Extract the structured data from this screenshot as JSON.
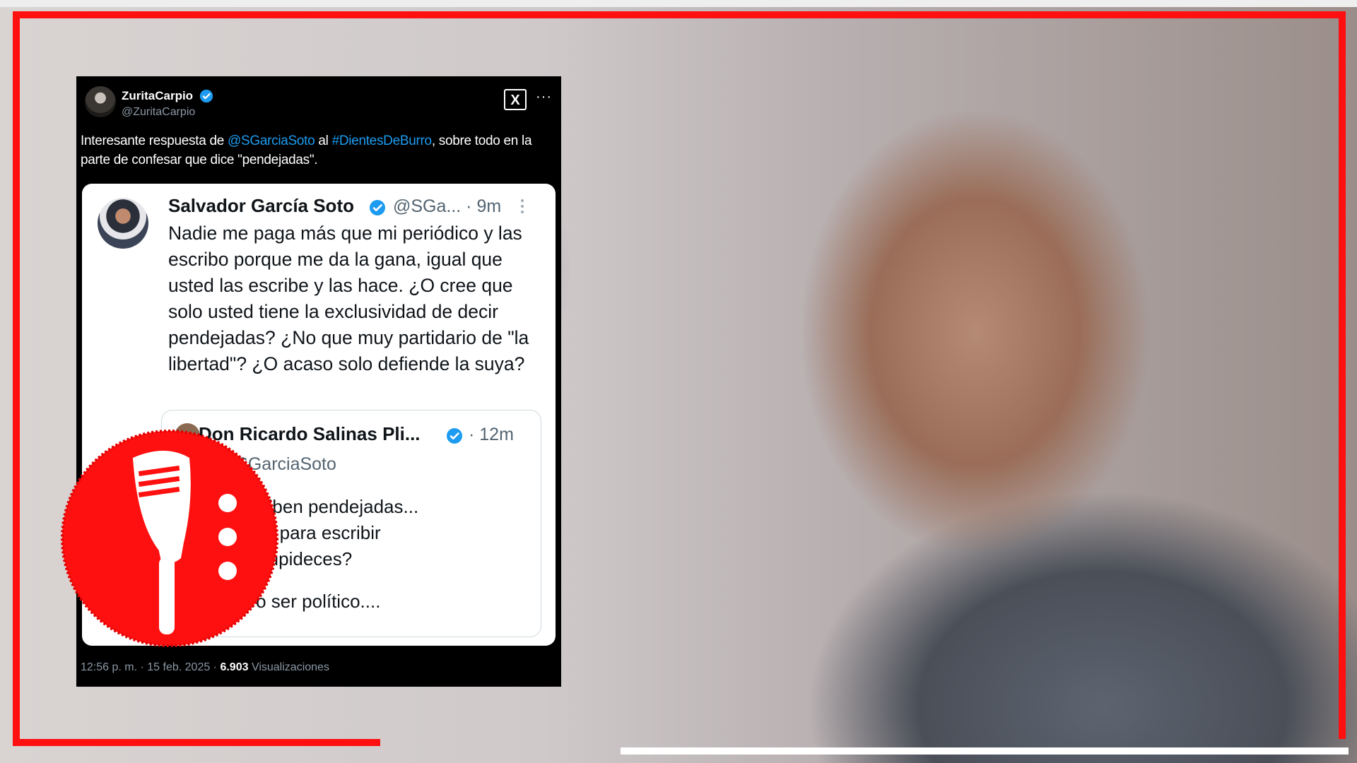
{
  "tweet": {
    "author_name": "ZuritaCarpio",
    "author_handle": "@ZuritaCarpio",
    "x_label": "X",
    "more_label": "···",
    "text_part1": "Interesante respuesta de ",
    "mention": "@SGarciaSoto",
    "text_part2": " al ",
    "hashtag": "#DientesDeBurro",
    "text_part3": ", sobre todo en la parte de confesar que dice \"pendejadas\".",
    "timestamp": "12:56 p. m. · 15 feb. 2025 · ",
    "views_count": "6.903",
    "views_label": " Visualizaciones"
  },
  "embedded": {
    "author_name": "Salvador García Soto",
    "author_handle_time": "@SGa... · 9m",
    "text": "Nadie me paga más que mi periódico y las escribo porque me da la gana, igual que usted las escribe y las hace. ¿O cree que solo usted tiene la exclusividad de decir pendejadas? ¿No que muy partidario de \"la libertad\"? ¿O acaso solo defiende la suya?",
    "quote": {
      "author_name": "Don Ricardo Salinas Pli...",
      "time": "· 12m",
      "reply_to": "to @SGarciaSoto",
      "lines": [
        "scriben pendejadas...",
        "ago para escribir",
        "estupideces?",
        "ero ser político...."
      ]
    }
  },
  "colors": {
    "frame_red": "#ff1010",
    "link_blue": "#1d9bf0",
    "verified_blue": "#1d9bf0",
    "logo_red": "#ff1010"
  },
  "icons": {
    "verified": "verified-badge-icon",
    "logo": "microphone-logo-icon"
  }
}
